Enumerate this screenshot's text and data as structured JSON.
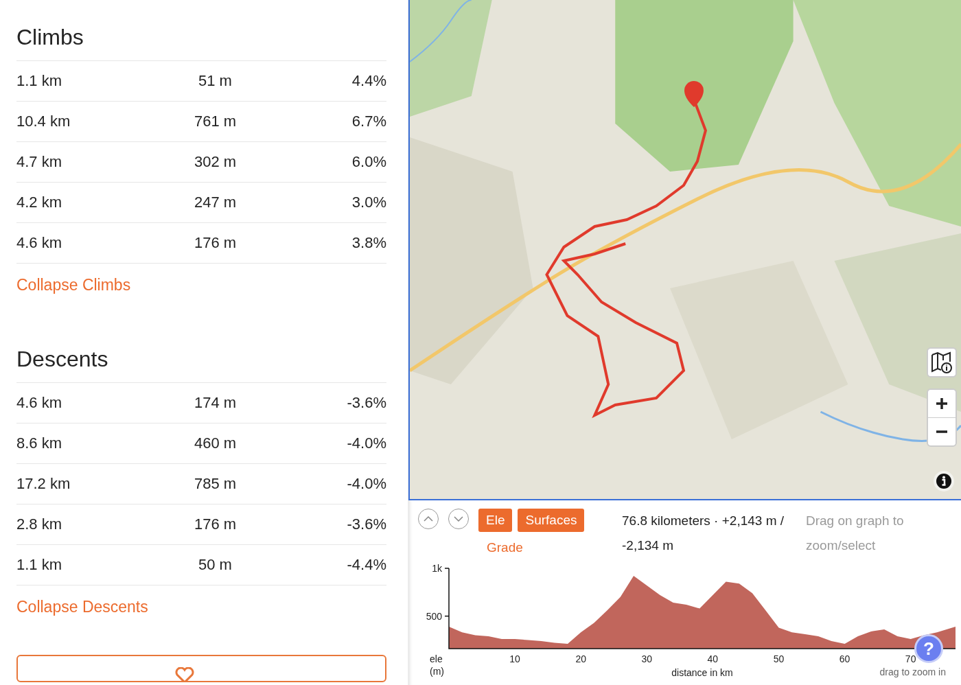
{
  "sections": [
    {
      "title": "Climbs",
      "rows": [
        [
          "1.1 km",
          "51 m",
          "4.4%"
        ],
        [
          "10.4 km",
          "761 m",
          "6.7%"
        ],
        [
          "4.7 km",
          "302 m",
          "6.0%"
        ],
        [
          "4.2 km",
          "247 m",
          "3.0%"
        ],
        [
          "4.6 km",
          "176 m",
          "3.8%"
        ]
      ],
      "collapse_link": "Collapse Climbs"
    },
    {
      "title": "Descents",
      "rows": [
        [
          "4.6 km",
          "174 m",
          "-3.6%"
        ],
        [
          "8.6 km",
          "460 m",
          "-4.0%"
        ],
        [
          "17.2 km",
          "785 m",
          "-4.0%"
        ],
        [
          "2.8 km",
          "176 m",
          "-3.6%"
        ],
        [
          "1.1 km",
          "50 m",
          "-4.4%"
        ]
      ],
      "collapse_link": "Collapse Descents"
    }
  ],
  "elevation_panel": {
    "tabs": [
      {
        "label": "Ele",
        "selected": true
      },
      {
        "label": "Surfaces",
        "selected": true
      },
      {
        "label": "Grade",
        "selected": false
      }
    ],
    "summary": "76.8 kilometers · +2,143 m / -2,134 m",
    "hint": "Drag on graph to zoom/select",
    "zoom_hint": "drag to zoom in",
    "help_button": "?",
    "chart_data": {
      "type": "area",
      "xlabel": "distance in km",
      "ylabel": "ele (m)",
      "x": [
        0,
        2,
        4,
        6,
        8,
        10,
        12,
        14,
        16,
        18,
        20,
        22,
        24,
        26,
        28,
        30,
        32,
        34,
        36,
        38,
        40,
        42,
        44,
        46,
        48,
        50,
        52,
        54,
        56,
        58,
        60,
        62,
        64,
        66,
        68,
        70,
        72,
        74,
        76.8
      ],
      "series": [
        {
          "color": "#c1665c",
          "values": [
            390,
            330,
            300,
            290,
            260,
            260,
            250,
            240,
            220,
            210,
            330,
            430,
            560,
            700,
            920,
            820,
            720,
            640,
            620,
            580,
            720,
            860,
            840,
            740,
            560,
            380,
            330,
            310,
            290,
            240,
            210,
            290,
            340,
            360,
            290,
            260,
            300,
            330,
            390
          ]
        }
      ],
      "xlim": [
        0,
        76.8
      ],
      "ylim": [
        160,
        1000
      ],
      "xticks": [
        10,
        20,
        30,
        40,
        50,
        60,
        70
      ],
      "yticks": [
        500,
        {
          "value": 1000,
          "label": "1k"
        }
      ]
    }
  }
}
